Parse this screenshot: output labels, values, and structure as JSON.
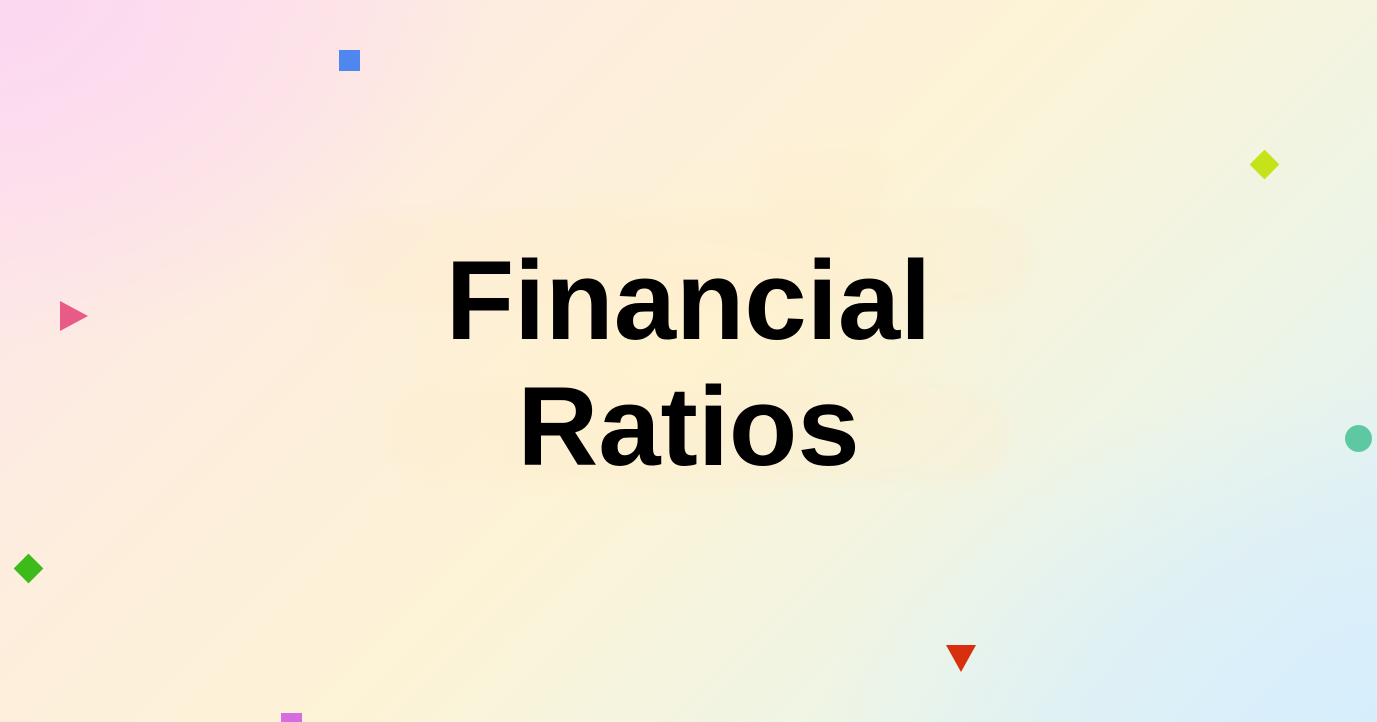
{
  "slide": {
    "title_line1": "Financial",
    "title_line2": "Ratios"
  },
  "decorations": [
    {
      "name": "blue-square",
      "color": "#4f86f0"
    },
    {
      "name": "lime-diamond",
      "color": "#c6e21a"
    },
    {
      "name": "pink-triangle",
      "color": "#e85b86"
    },
    {
      "name": "teal-circle",
      "color": "#5ec8a3"
    },
    {
      "name": "green-diamond",
      "color": "#3dbb1a"
    },
    {
      "name": "red-triangle",
      "color": "#d8300f"
    },
    {
      "name": "purple-square",
      "color": "#d46ee0"
    }
  ]
}
